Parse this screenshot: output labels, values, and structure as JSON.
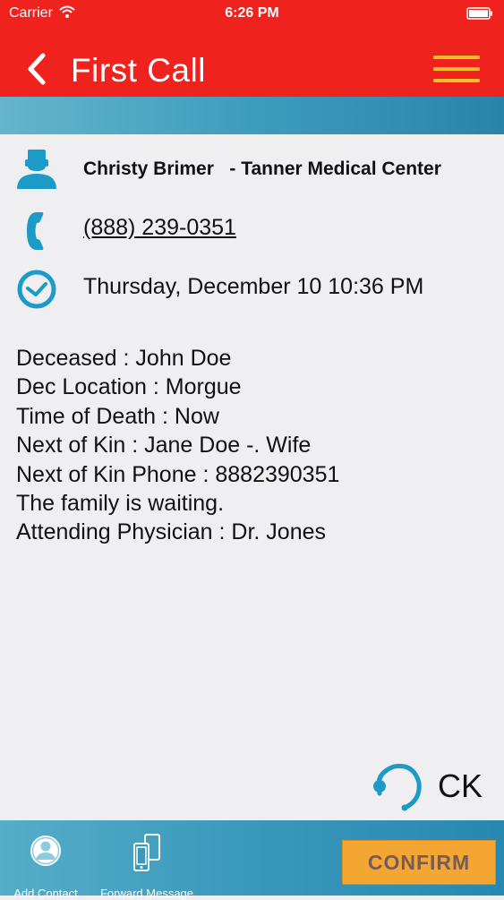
{
  "status_bar": {
    "carrier": "Carrier",
    "time": "6:26 PM"
  },
  "nav": {
    "title": "First Call"
  },
  "contact": {
    "name": "Christy Brimer   - Tanner Medical Center",
    "phone": "(888) 239-0351",
    "datetime": "Thursday, December 10 10:36 PM"
  },
  "details": [
    "Deceased : John Doe",
    "Dec Location : Morgue",
    "Time of Death : Now",
    "Next of Kin : Jane Doe -. Wife",
    "Next of Kin Phone : 8882390351",
    "The family is waiting.",
    "Attending Physician : Dr. Jones"
  ],
  "agent": {
    "initials": "CK"
  },
  "footer": {
    "add_contact": "Add Contact",
    "forward_message": "Forward Message",
    "confirm": "CONFIRM"
  },
  "colors": {
    "header": "#f0221d",
    "menu_icon": "#f5bd2a",
    "accent_blue": "#1c9bc9",
    "confirm": "#f3a632"
  },
  "icons": {
    "contact": "person-icon",
    "phone": "phone-icon",
    "time": "clock-icon",
    "agent": "headset-icon",
    "add_contact": "add-contact-icon",
    "forward": "forward-devices-icon"
  }
}
